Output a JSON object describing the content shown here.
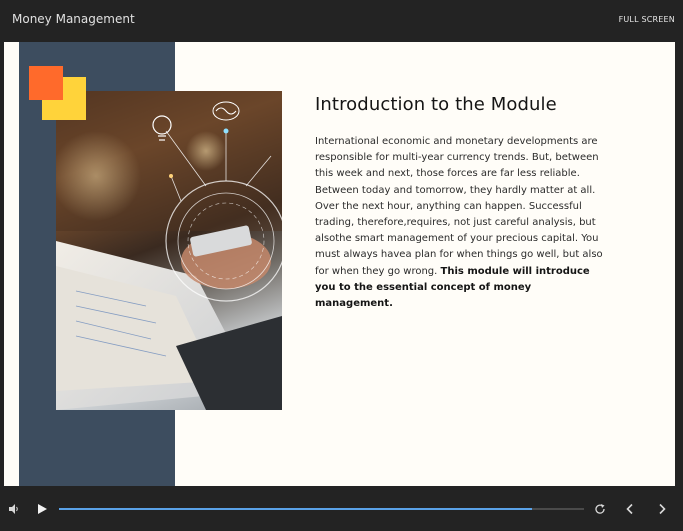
{
  "header": {
    "title": "Money Management",
    "fullscreen_label": "FULL SCREEN"
  },
  "slide": {
    "heading": "Introduction to the Module",
    "body_plain": "International economic and monetary developments are responsible for multi-year currency trends. But, between this week and next, those forces are far less reliable. Between today and tomorrow, they hardly matter at all. Over the next hour, anything can happen. Successful trading, therefore,requires, not just careful analysis, but alsothe smart management of your precious capital. You must always havea plan for when things go well, but also for when they go wrong.",
    "body_bold": "This module will introduce you to the essential concept of money management.",
    "colors": {
      "band": "#3d4d5f",
      "accent_orange": "#ff6a2b",
      "accent_yellow": "#ffd33a"
    }
  },
  "player": {
    "progress": 0.9,
    "progress_color": "#5aa2e8",
    "icons": [
      "volume-icon",
      "play-icon",
      "reload-icon",
      "previous-icon",
      "next-icon"
    ]
  }
}
